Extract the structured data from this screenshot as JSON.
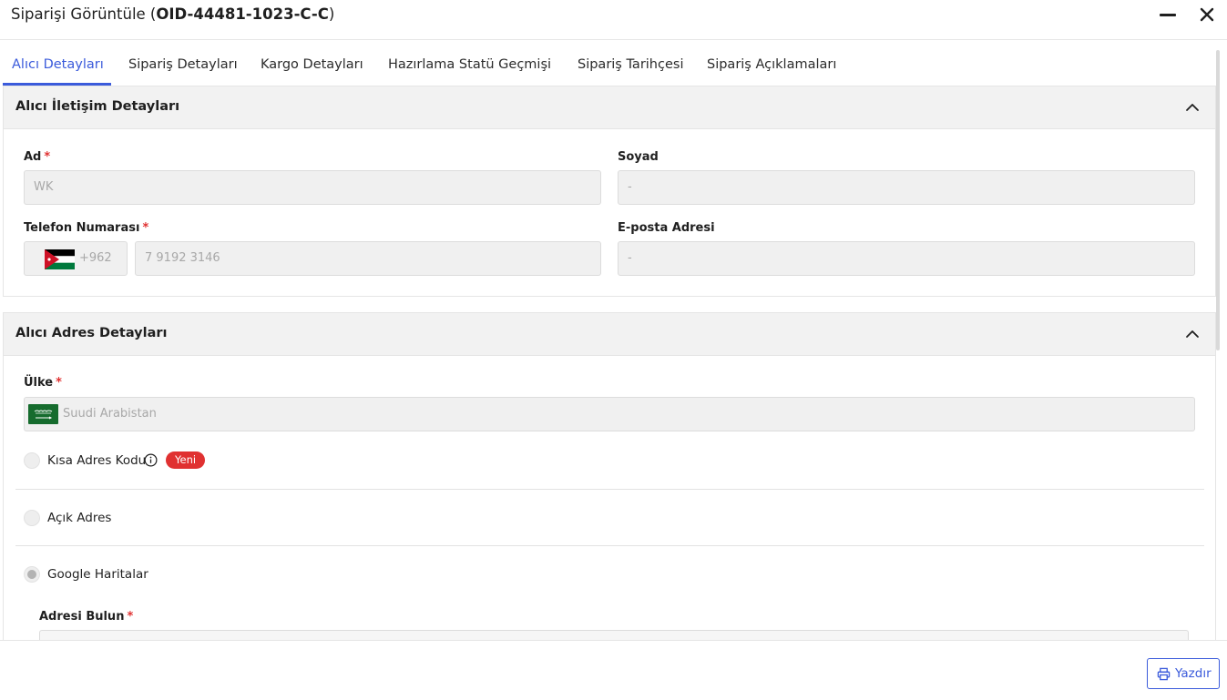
{
  "header": {
    "title_prefix": "Siparişi Görüntüle (",
    "order_id": "OID-44481-1023-C-C",
    "title_suffix": ")"
  },
  "tabs": [
    {
      "label": "Alıcı Detayları",
      "active": true
    },
    {
      "label": "Sipariş Detayları"
    },
    {
      "label": "Kargo Detayları"
    },
    {
      "label": "Hazırlama Statü Geçmişi"
    },
    {
      "label": "Sipariş Tarihçesi"
    },
    {
      "label": "Sipariş Açıklamaları"
    }
  ],
  "contact_section": {
    "title": "Alıcı İletişim Detayları",
    "first_name": {
      "label": "Ad",
      "required": "*",
      "value": "WK"
    },
    "last_name": {
      "label": "Soyad",
      "value": "-"
    },
    "phone": {
      "label": "Telefon Numarası",
      "required": "*",
      "country_code": "+962",
      "value": "7 9192 3146"
    },
    "email": {
      "label": "E-posta Adresi",
      "value": "-"
    }
  },
  "address_section": {
    "title": "Alıcı Adres Detayları",
    "country": {
      "label": "Ülke",
      "required": "*",
      "value": "Suudi Arabistan"
    },
    "options": [
      {
        "label": "Kısa Adres Kodu",
        "badge": "Yeni",
        "checked": false
      },
      {
        "label": "Açık Adres",
        "checked": false
      },
      {
        "label": "Google Haritalar",
        "checked": true
      }
    ],
    "find_address": {
      "label": "Adresi Bulun",
      "required": "*"
    }
  },
  "footer": {
    "print_label": "Yazdır"
  },
  "colors": {
    "accent": "#3b5bdb",
    "required": "#e03131",
    "badge": "#e03131"
  }
}
